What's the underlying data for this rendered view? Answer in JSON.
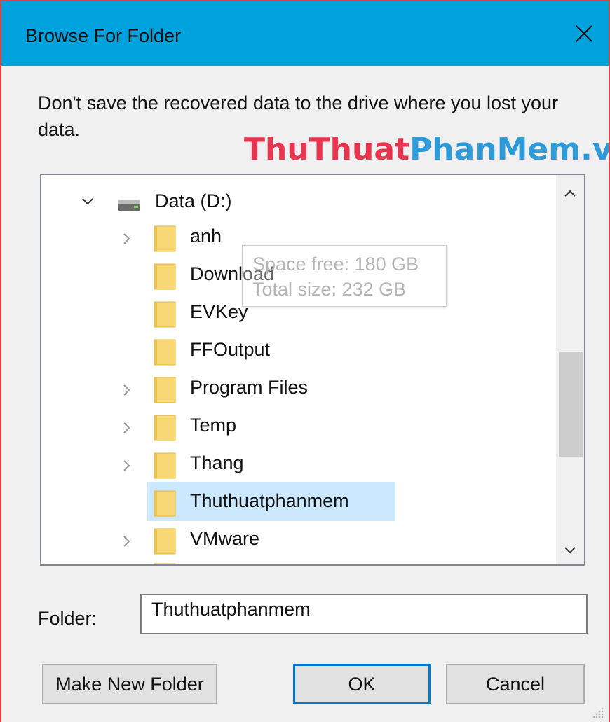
{
  "window": {
    "title": "Browse For Folder",
    "close_glyph": "✕"
  },
  "instruction": "Don't save the recovered data to the drive where you lost your data.",
  "watermark": {
    "part1": "ThuThuat",
    "part2": "PhanMem.vn"
  },
  "tree": {
    "drive": {
      "label": "Data (D:)",
      "expanded": true
    },
    "folders": [
      {
        "label": "anh",
        "expandable": true
      },
      {
        "label": "Download",
        "expandable": false
      },
      {
        "label": "EVKey",
        "expandable": false
      },
      {
        "label": "FFOutput",
        "expandable": false
      },
      {
        "label": "Program Files",
        "expandable": true
      },
      {
        "label": "Temp",
        "expandable": true
      },
      {
        "label": "Thang",
        "expandable": true
      },
      {
        "label": "Thuthuatphanmem",
        "expandable": false,
        "selected": true
      },
      {
        "label": "VMware",
        "expandable": true
      }
    ]
  },
  "tooltip": {
    "line1": "Space free: 180 GB",
    "line2": "Total size: 232 GB"
  },
  "folder_field": {
    "label": "Folder:",
    "value": "Thuthuatphanmem"
  },
  "buttons": {
    "make_new_folder": "Make New Folder",
    "ok": "OK",
    "cancel": "Cancel"
  },
  "colors": {
    "titlebar": "#00a2dd",
    "selection": "#cce8ff",
    "ok_border": "#0078d7",
    "watermark_red": "#e8344f",
    "watermark_blue": "#2f9ad8"
  }
}
